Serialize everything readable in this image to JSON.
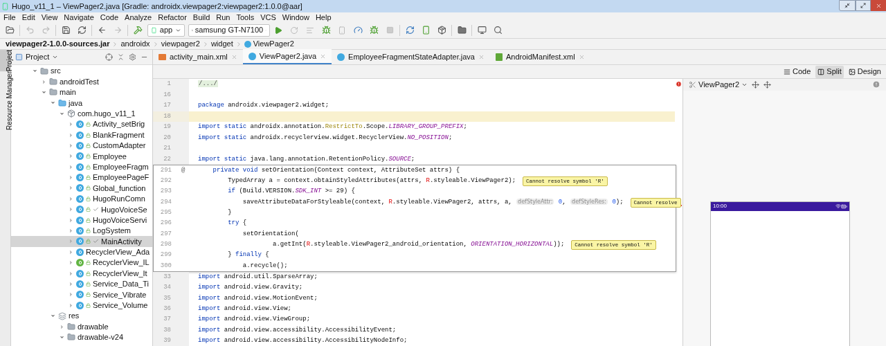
{
  "window": {
    "title": "Hugo_v11_1 – ViewPager2.java [Gradle: androidx.viewpager2:viewpager2:1.0.0@aar]"
  },
  "menu": [
    "File",
    "Edit",
    "View",
    "Navigate",
    "Code",
    "Analyze",
    "Refactor",
    "Build",
    "Run",
    "Tools",
    "VCS",
    "Window",
    "Help"
  ],
  "toolbar": {
    "run_config": "app",
    "device": "samsung GT-N7100"
  },
  "breadcrumbs": [
    "viewpager2-1.0.0-sources.jar",
    "androidx",
    "viewpager2",
    "widget",
    "ViewPager2"
  ],
  "side_tabs": [
    {
      "label": "Project",
      "selected": true
    },
    {
      "label": "Resource Manager",
      "selected": false
    }
  ],
  "project": {
    "title": "Project",
    "tree": [
      {
        "name": "src",
        "kind": "folder",
        "expanded": true,
        "children": [
          {
            "name": "androidTest",
            "kind": "folder",
            "expanded": false
          },
          {
            "name": "main",
            "kind": "folder",
            "expanded": true,
            "children": [
              {
                "name": "java",
                "kind": "source",
                "expanded": true,
                "children": [
                  {
                    "name": "com.hugo_v11_1",
                    "kind": "package",
                    "expanded": true,
                    "children": [
                      {
                        "name": "Activity_setBrig",
                        "kind": "class",
                        "expanded": false,
                        "ticked": false,
                        "selected": false
                      },
                      {
                        "name": "BlankFragment",
                        "kind": "class",
                        "expanded": false,
                        "ticked": false,
                        "selected": false
                      },
                      {
                        "name": "CustomAdapter",
                        "kind": "class",
                        "expanded": false,
                        "ticked": false,
                        "selected": false
                      },
                      {
                        "name": "Employee",
                        "kind": "class",
                        "expanded": false,
                        "ticked": false,
                        "selected": false
                      },
                      {
                        "name": "EmployeeFragm",
                        "kind": "class",
                        "expanded": false,
                        "ticked": false,
                        "selected": false
                      },
                      {
                        "name": "EmployeePageF",
                        "kind": "class",
                        "expanded": false,
                        "ticked": false,
                        "selected": false
                      },
                      {
                        "name": "Global_function",
                        "kind": "class",
                        "expanded": false,
                        "ticked": false,
                        "selected": false
                      },
                      {
                        "name": "HugoRunComn",
                        "kind": "class",
                        "expanded": false,
                        "ticked": false,
                        "selected": false
                      },
                      {
                        "name": "HugoVoiceSe",
                        "kind": "class",
                        "expanded": false,
                        "ticked": true,
                        "selected": false
                      },
                      {
                        "name": "HugoVoiceServi",
                        "kind": "class",
                        "expanded": false,
                        "ticked": false,
                        "selected": false
                      },
                      {
                        "name": "LogSystem",
                        "kind": "class",
                        "expanded": false,
                        "ticked": false,
                        "selected": false
                      },
                      {
                        "name": "MainActivity",
                        "kind": "class",
                        "expanded": false,
                        "ticked": true,
                        "selected": true
                      },
                      {
                        "name": "RecyclerView_Ada",
                        "kind": "plainclass",
                        "expanded": false,
                        "ticked": false,
                        "selected": false
                      },
                      {
                        "name": "RecyclerView_IL",
                        "kind": "interface",
                        "expanded": false,
                        "ticked": false,
                        "selected": false
                      },
                      {
                        "name": "RecyclerView_It",
                        "kind": "class",
                        "expanded": false,
                        "ticked": false,
                        "selected": false
                      },
                      {
                        "name": "Service_Data_Ti",
                        "kind": "class",
                        "expanded": false,
                        "ticked": false,
                        "selected": false
                      },
                      {
                        "name": "Service_Vibrate",
                        "kind": "class",
                        "expanded": false,
                        "ticked": false,
                        "selected": false
                      },
                      {
                        "name": "Service_Volume",
                        "kind": "class",
                        "expanded": false,
                        "ticked": false,
                        "selected": false
                      }
                    ]
                  }
                ]
              },
              {
                "name": "res",
                "kind": "resources",
                "expanded": true,
                "children": [
                  {
                    "name": "drawable",
                    "kind": "folder",
                    "expanded": false
                  },
                  {
                    "name": "drawable-v24",
                    "kind": "folder",
                    "expanded": true
                  }
                ]
              }
            ]
          }
        ]
      }
    ]
  },
  "tabs": [
    {
      "label": "activity_main.xml",
      "kind": "xml",
      "selected": false
    },
    {
      "label": "ViewPager2.java",
      "kind": "java",
      "selected": true
    },
    {
      "label": "EmployeeFragmentStateAdapter.java",
      "kind": "java",
      "selected": false
    },
    {
      "label": "AndroidManifest.xml",
      "kind": "manifest",
      "selected": false
    }
  ],
  "view_modes": [
    {
      "label": "Code",
      "kind": "code",
      "selected": false
    },
    {
      "label": "Split",
      "kind": "split",
      "selected": true
    },
    {
      "label": "Design",
      "kind": "design",
      "selected": false
    }
  ],
  "editor": {
    "lines_top": [
      {
        "number": "1",
        "current": false,
        "segments": [
          {
            "kind": "folded",
            "text": "/.../"
          }
        ]
      },
      {
        "number": "16",
        "current": false
      },
      {
        "number": "17",
        "current": false,
        "segments": [
          {
            "kind": "kw",
            "text": "package"
          },
          {
            "kind": "plain",
            "text": " androidx.viewpager2.widget;"
          }
        ]
      },
      {
        "number": "18",
        "current": true
      },
      {
        "number": "19",
        "current": false,
        "segments": [
          {
            "kind": "kw",
            "text": "import static"
          },
          {
            "kind": "plain",
            "text": " androidx.annotation."
          },
          {
            "kind": "ann",
            "text": "RestrictTo"
          },
          {
            "kind": "plain",
            "text": ".Scope."
          },
          {
            "kind": "const",
            "text": "LIBRARY_GROUP_PREFIX"
          },
          {
            "kind": "plain",
            "text": ";"
          }
        ]
      },
      {
        "number": "20",
        "current": false,
        "segments": [
          {
            "kind": "kw",
            "text": "import static"
          },
          {
            "kind": "plain",
            "text": " androidx.recyclerview.widget.RecyclerView."
          },
          {
            "kind": "const",
            "text": "NO_POSITION"
          },
          {
            "kind": "plain",
            "text": ";"
          }
        ]
      },
      {
        "number": "21",
        "current": false
      },
      {
        "number": "22",
        "current": false,
        "segments": [
          {
            "kind": "kw",
            "text": "import static"
          },
          {
            "kind": "plain",
            "text": " java.lang.annotation.RetentionPolicy."
          },
          {
            "kind": "const",
            "text": "SOURCE"
          },
          {
            "kind": "plain",
            "text": ";"
          }
        ]
      }
    ],
    "popup_lines": [
      {
        "number": "291",
        "marker": "@",
        "segments": [
          {
            "kind": "kw",
            "text": "    private void"
          },
          {
            "kind": "plain",
            "text": " setOrientation(Context context, AttributeSet attrs) {"
          }
        ]
      },
      {
        "number": "292",
        "segments": [
          {
            "kind": "plain",
            "text": "        TypedArray a = context.obtainStyledAttributes(attrs, "
          },
          {
            "kind": "err",
            "text": "R"
          },
          {
            "kind": "plain",
            "text": ".styleable.ViewPager2);"
          }
        ],
        "error": "Cannot resolve symbol 'R'"
      },
      {
        "number": "293",
        "segments": [
          {
            "kind": "kw",
            "text": "        if"
          },
          {
            "kind": "plain",
            "text": " (Build.VERSION."
          },
          {
            "kind": "const",
            "text": "SDK_INT"
          },
          {
            "kind": "plain",
            "text": " >= 29) {"
          }
        ]
      },
      {
        "number": "294",
        "segments": [
          {
            "kind": "plain",
            "text": "            saveAttributeDataForStyleable(context, "
          },
          {
            "kind": "err",
            "text": "R"
          },
          {
            "kind": "plain",
            "text": ".styleable.ViewPager2, attrs, a, "
          },
          {
            "kind": "hint",
            "text": "defStyleAttr:"
          },
          {
            "kind": "num",
            "text": " 0"
          },
          {
            "kind": "plain",
            "text": ", "
          },
          {
            "kind": "hint",
            "text": "defStyleRes:"
          },
          {
            "kind": "num",
            "text": " 0"
          },
          {
            "kind": "plain",
            "text": ");"
          }
        ],
        "error": "Cannot resolve"
      },
      {
        "number": "295",
        "segments": [
          {
            "kind": "plain",
            "text": "        }"
          }
        ]
      },
      {
        "number": "296",
        "segments": [
          {
            "kind": "kw",
            "text": "        try"
          },
          {
            "kind": "plain",
            "text": " {"
          }
        ]
      },
      {
        "number": "297",
        "segments": [
          {
            "kind": "plain",
            "text": "            setOrientation("
          }
        ]
      },
      {
        "number": "298",
        "segments": [
          {
            "kind": "plain",
            "text": "                    a.getInt("
          },
          {
            "kind": "err",
            "text": "R"
          },
          {
            "kind": "plain",
            "text": ".styleable.ViewPager2_android_orientation, "
          },
          {
            "kind": "const",
            "text": "ORIENTATION_HORIZONTAL"
          },
          {
            "kind": "plain",
            "text": "));"
          }
        ],
        "error": "Cannot resolve symbol 'R'"
      },
      {
        "number": "299",
        "segments": [
          {
            "kind": "plain",
            "text": "        } "
          },
          {
            "kind": "kw",
            "text": "finally"
          },
          {
            "kind": "plain",
            "text": " {"
          }
        ]
      },
      {
        "number": "300",
        "segments": [
          {
            "kind": "plain",
            "text": "            a.recycle();"
          }
        ]
      }
    ],
    "lines_bottom": [
      {
        "number": "33",
        "segments": [
          {
            "kind": "kw",
            "text": "import"
          },
          {
            "kind": "plain",
            "text": " android.util.SparseArray;"
          }
        ]
      },
      {
        "number": "34",
        "segments": [
          {
            "kind": "kw",
            "text": "import"
          },
          {
            "kind": "plain",
            "text": " android.view.Gravity;"
          }
        ]
      },
      {
        "number": "35",
        "segments": [
          {
            "kind": "kw",
            "text": "import"
          },
          {
            "kind": "plain",
            "text": " android.view.MotionEvent;"
          }
        ]
      },
      {
        "number": "36",
        "segments": [
          {
            "kind": "kw",
            "text": "import"
          },
          {
            "kind": "plain",
            "text": " android.view.View;"
          }
        ]
      },
      {
        "number": "37",
        "segments": [
          {
            "kind": "kw",
            "text": "import"
          },
          {
            "kind": "plain",
            "text": " android.view.ViewGroup;"
          }
        ]
      },
      {
        "number": "38",
        "segments": [
          {
            "kind": "kw",
            "text": "import"
          },
          {
            "kind": "plain",
            "text": " android.view.accessibility.AccessibilityEvent;"
          }
        ]
      },
      {
        "number": "39",
        "segments": [
          {
            "kind": "kw",
            "text": "import"
          },
          {
            "kind": "plain",
            "text": " android.view.accessibility.AccessibilityNodeInfo;"
          }
        ]
      }
    ]
  },
  "preview": {
    "component": "ViewPager2",
    "device_time": "10:00"
  }
}
